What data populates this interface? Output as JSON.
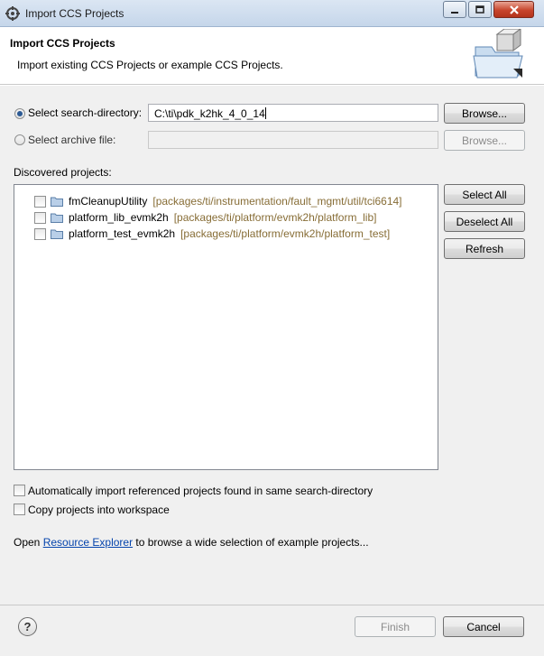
{
  "window": {
    "title": "Import CCS Projects",
    "min_glyph": "▁",
    "max_glyph": "□",
    "close_glyph": "✕"
  },
  "header": {
    "title": "Import CCS Projects",
    "description": "Import existing CCS Projects or example CCS Projects."
  },
  "source": {
    "search_dir_label": "Select search-directory:",
    "search_dir_value": "C:\\ti\\pdk_k2hk_4_0_14",
    "search_dir_selected": true,
    "archive_label": "Select archive file:",
    "archive_value": "",
    "browse_label": "Browse..."
  },
  "projects": {
    "label": "Discovered projects:",
    "items": [
      {
        "name": "fmCleanupUtility",
        "path": "[packages/ti/instrumentation/fault_mgmt/util/tci6614]",
        "checked": false
      },
      {
        "name": "platform_lib_evmk2h",
        "path": "[packages/ti/platform/evmk2h/platform_lib]",
        "checked": false
      },
      {
        "name": "platform_test_evmk2h",
        "path": "[packages/ti/platform/evmk2h/platform_test]",
        "checked": false
      }
    ],
    "select_all_label": "Select All",
    "deselect_all_label": "Deselect All",
    "refresh_label": "Refresh"
  },
  "options": {
    "auto_import_label": "Automatically import referenced projects found in same search-directory",
    "copy_label": "Copy projects into workspace"
  },
  "resource_text": {
    "before": "Open ",
    "link": "Resource Explorer",
    "after": " to browse a wide selection of example projects..."
  },
  "footer": {
    "help_glyph": "?",
    "finish_label": "Finish",
    "cancel_label": "Cancel"
  }
}
